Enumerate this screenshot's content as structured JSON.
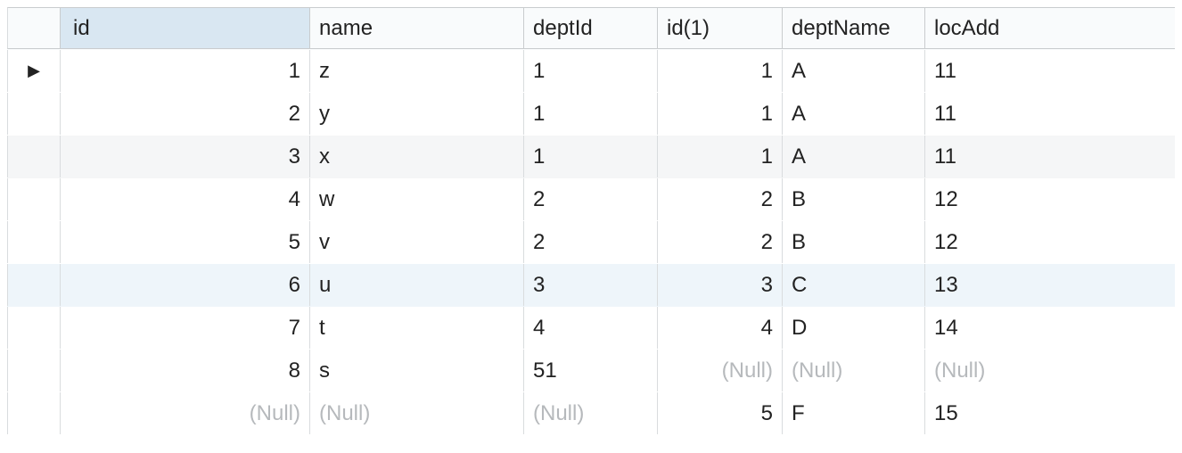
{
  "null_label": "(Null)",
  "columns": {
    "id": "id",
    "name": "name",
    "deptId": "deptId",
    "id1": "id(1)",
    "deptName": "deptName",
    "locAdd": "locAdd"
  },
  "current_row_indicator": "▶",
  "rows": [
    {
      "id": "1",
      "name": "z",
      "deptId": "1",
      "id1": "1",
      "deptName": "A",
      "locAdd": "11",
      "current": true,
      "shade": "none"
    },
    {
      "id": "2",
      "name": "y",
      "deptId": "1",
      "id1": "1",
      "deptName": "A",
      "locAdd": "11",
      "current": false,
      "shade": "none"
    },
    {
      "id": "3",
      "name": "x",
      "deptId": "1",
      "id1": "1",
      "deptName": "A",
      "locAdd": "11",
      "current": false,
      "shade": "grey"
    },
    {
      "id": "4",
      "name": "w",
      "deptId": "2",
      "id1": "2",
      "deptName": "B",
      "locAdd": "12",
      "current": false,
      "shade": "none"
    },
    {
      "id": "5",
      "name": "v",
      "deptId": "2",
      "id1": "2",
      "deptName": "B",
      "locAdd": "12",
      "current": false,
      "shade": "none"
    },
    {
      "id": "6",
      "name": "u",
      "deptId": "3",
      "id1": "3",
      "deptName": "C",
      "locAdd": "13",
      "current": false,
      "shade": "blue"
    },
    {
      "id": "7",
      "name": "t",
      "deptId": "4",
      "id1": "4",
      "deptName": "D",
      "locAdd": "14",
      "current": false,
      "shade": "none"
    },
    {
      "id": "8",
      "name": "s",
      "deptId": "51",
      "id1": null,
      "deptName": null,
      "locAdd": null,
      "current": false,
      "shade": "none"
    },
    {
      "id": null,
      "name": null,
      "deptId": null,
      "id1": "5",
      "deptName": "F",
      "locAdd": "15",
      "current": false,
      "shade": "none"
    }
  ]
}
